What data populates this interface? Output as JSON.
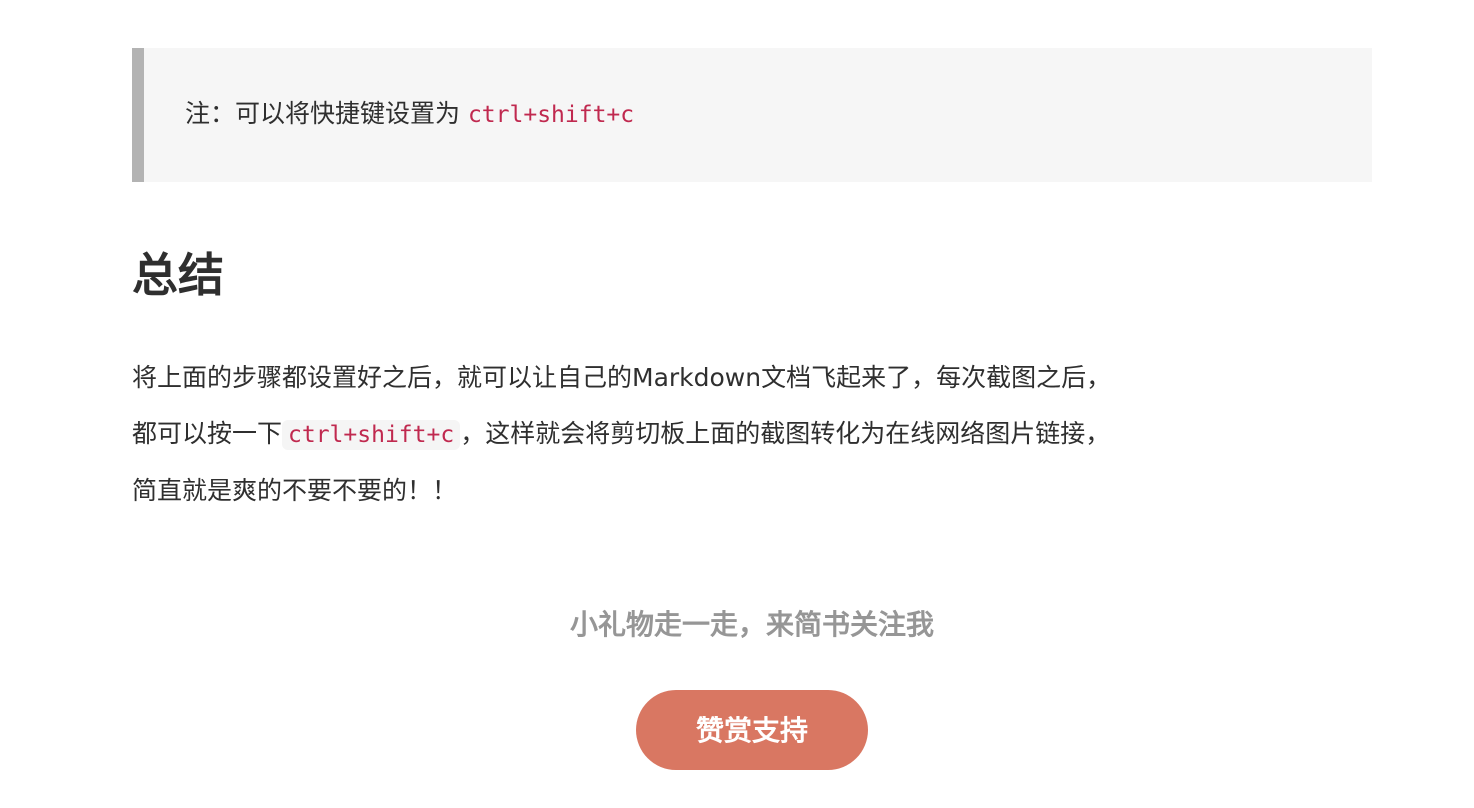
{
  "note": {
    "text": "注：可以将快捷键设置为 ",
    "shortcut": "ctrl+shift+c"
  },
  "summary": {
    "heading": "总结",
    "line1": "将上面的步骤都设置好之后，就可以让自己的Markdown文档飞起来了，每次截图之后，",
    "line2_pre": "都可以按一下",
    "line2_code": "ctrl+shift+c",
    "line2_post": "，这样就会将剪切板上面的截图转化为在线网络图片链接，",
    "line3": "简直就是爽的不要不要的！！"
  },
  "gift": {
    "text": "小礼物走一走，来简书关注我",
    "button": "赞赏支持"
  }
}
